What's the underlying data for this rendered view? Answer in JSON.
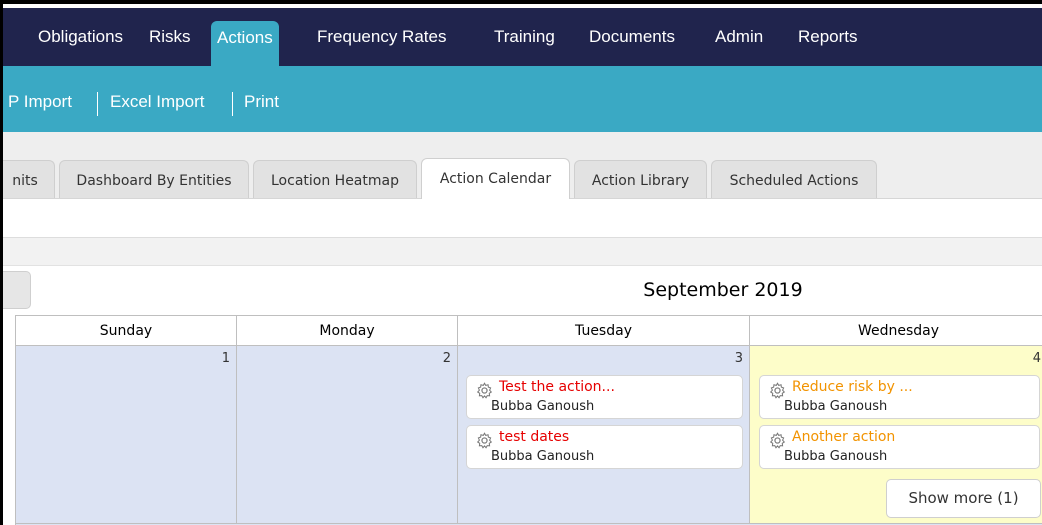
{
  "topnav": {
    "items": [
      {
        "label": "Obligations",
        "active": false
      },
      {
        "label": "Risks",
        "active": false
      },
      {
        "label": "Actions",
        "active": true
      },
      {
        "label": "Frequency Rates",
        "active": false
      },
      {
        "label": "Training",
        "active": false
      },
      {
        "label": "Documents",
        "active": false
      },
      {
        "label": "Admin",
        "active": false
      },
      {
        "label": "Reports",
        "active": false
      }
    ]
  },
  "subbar": {
    "links": [
      "P Import",
      "Excel Import",
      "Print"
    ]
  },
  "tabs": [
    {
      "label": "nits",
      "active": false
    },
    {
      "label": "Dashboard By Entities",
      "active": false
    },
    {
      "label": "Location Heatmap",
      "active": false
    },
    {
      "label": "Action Calendar",
      "active": true
    },
    {
      "label": "Action Library",
      "active": false
    },
    {
      "label": "Scheduled Actions",
      "active": false
    }
  ],
  "calendar": {
    "title": "September 2019",
    "weekdays": [
      "Sunday",
      "Monday",
      "Tuesday",
      "Wednesday"
    ],
    "days": [
      {
        "number": "1",
        "events": []
      },
      {
        "number": "2",
        "events": []
      },
      {
        "number": "3",
        "events": [
          {
            "title": "Test the action...",
            "owner": "Bubba Ganoush",
            "color": "#e60000",
            "icon": "gear-icon"
          },
          {
            "title": "test dates",
            "owner": "Bubba Ganoush",
            "color": "#e60000",
            "icon": "gear-icon"
          }
        ]
      },
      {
        "number": "4",
        "today": true,
        "events": [
          {
            "title": "Reduce risk by ...",
            "owner": "Bubba Ganoush",
            "color": "#f29300",
            "icon": "gear-icon"
          },
          {
            "title": "Another action",
            "owner": "Bubba Ganoush",
            "color": "#f29300",
            "icon": "gear-icon"
          }
        ],
        "show_more": "Show more (1)"
      }
    ]
  },
  "colors": {
    "topnav_bg": "#20244d",
    "accent": "#3aa9c4",
    "day_bg": "#dce3f3",
    "today_bg": "#fdfdc9",
    "overdue": "#e60000",
    "due_soon": "#f29300"
  }
}
